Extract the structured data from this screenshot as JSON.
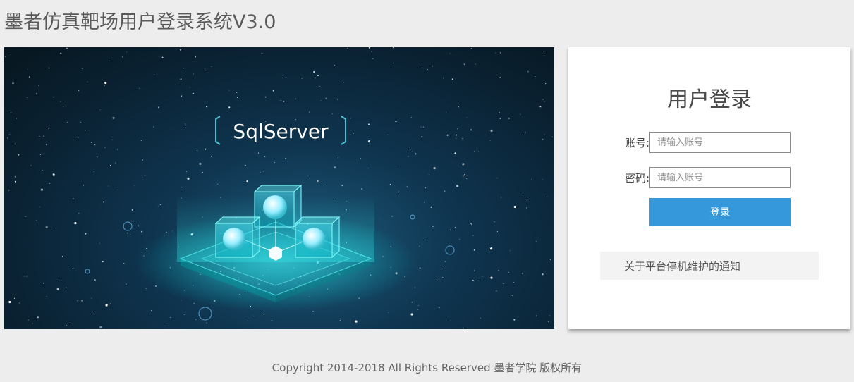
{
  "header": {
    "title": "墨者仿真靶场用户登录系统V3.0"
  },
  "banner": {
    "caption": "SqlServer",
    "image": "sqlserver-database-cubes-illustration"
  },
  "login": {
    "title": "用户登录",
    "username_label": "账号:",
    "username_placeholder": "请输入账号",
    "password_label": "密码:",
    "password_placeholder": "请输入账号",
    "submit_label": "登录",
    "notice_text": "关于平台停机维护的通知"
  },
  "footer": {
    "copyright": "Copyright 2014-2018 All Rights Reserved 墨者学院 版权所有"
  },
  "colors": {
    "background": "#ededed",
    "primary_button": "#3498db",
    "panel": "#ffffff",
    "notice_background": "#f3f3f3"
  }
}
